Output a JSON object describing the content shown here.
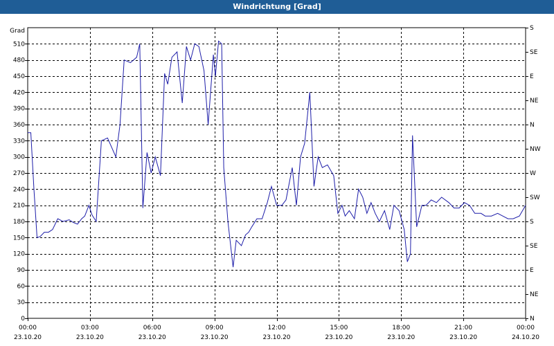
{
  "window": {
    "title": "Windrichtung [Grad]"
  },
  "colors": {
    "titlebar": "#1f5d96",
    "line": "#1c1ca8",
    "grid": "#000000"
  },
  "chart_data": {
    "type": "line",
    "title": "Windrichtung [Grad]",
    "ylabel": "Grad",
    "ylim": [
      0,
      540
    ],
    "yticks": [
      0,
      30,
      60,
      90,
      120,
      150,
      180,
      210,
      240,
      270,
      300,
      330,
      360,
      390,
      420,
      450,
      480,
      510
    ],
    "y2_labels": [
      {
        "value": 0,
        "label": "N"
      },
      {
        "value": 45,
        "label": "NE"
      },
      {
        "value": 90,
        "label": "E"
      },
      {
        "value": 135,
        "label": "SE"
      },
      {
        "value": 180,
        "label": "S"
      },
      {
        "value": 225,
        "label": "SW"
      },
      {
        "value": 270,
        "label": "W"
      },
      {
        "value": 315,
        "label": "NW"
      },
      {
        "value": 360,
        "label": "N"
      },
      {
        "value": 405,
        "label": "NE"
      },
      {
        "value": 450,
        "label": "E"
      },
      {
        "value": 495,
        "label": "SE"
      },
      {
        "value": 540,
        "label": "S"
      }
    ],
    "xlim": [
      0,
      24
    ],
    "xticks": [
      {
        "value": 0,
        "time": "00:00",
        "date": "23.10.20"
      },
      {
        "value": 3,
        "time": "03:00",
        "date": "23.10.20"
      },
      {
        "value": 6,
        "time": "06:00",
        "date": "23.10.20"
      },
      {
        "value": 9,
        "time": "09:00",
        "date": "23.10.20"
      },
      {
        "value": 12,
        "time": "12:00",
        "date": "23.10.20"
      },
      {
        "value": 15,
        "time": "15:00",
        "date": "23.10.20"
      },
      {
        "value": 18,
        "time": "18:00",
        "date": "23.10.20"
      },
      {
        "value": 21,
        "time": "21:00",
        "date": "23.10.20"
      },
      {
        "value": 24,
        "time": "00:00",
        "date": "24.10.20"
      }
    ],
    "grid": true,
    "series": [
      {
        "x": [
          0.0,
          0.15,
          0.3,
          0.45,
          0.6,
          0.8,
          1.0,
          1.2,
          1.45,
          1.7,
          2.0,
          2.2,
          2.4,
          2.6,
          2.75,
          2.95,
          3.1,
          3.3,
          3.55,
          3.85,
          4.25,
          4.45,
          4.65,
          4.95,
          5.25,
          5.4,
          5.55,
          5.75,
          5.95,
          6.15,
          6.4,
          6.6,
          6.75,
          6.95,
          7.2,
          7.45,
          7.65,
          7.85,
          8.05,
          8.25,
          8.5,
          8.7,
          8.95,
          9.05,
          9.2,
          9.35,
          9.45,
          9.65,
          9.9,
          10.05,
          10.3,
          10.5,
          10.65,
          10.8,
          11.05,
          11.3,
          11.55,
          11.75,
          12.0,
          12.25,
          12.45,
          12.75,
          12.95,
          13.15,
          13.35,
          13.6,
          13.8,
          14.0,
          14.2,
          14.45,
          14.75,
          14.95,
          15.15,
          15.3,
          15.5,
          15.75,
          15.95,
          16.15,
          16.35,
          16.55,
          16.75,
          16.95,
          17.2,
          17.45,
          17.65,
          17.9,
          18.15,
          18.3,
          18.45,
          18.55,
          18.75,
          19.0,
          19.2,
          19.45,
          19.7,
          19.95,
          20.3,
          20.55,
          20.8,
          21.05,
          21.3,
          21.55,
          21.85,
          22.05,
          22.35,
          22.65,
          22.9,
          23.15,
          23.4,
          23.7,
          24.0
        ],
        "values": [
          345,
          345,
          240,
          150,
          152,
          160,
          160,
          165,
          185,
          180,
          183,
          178,
          175,
          185,
          190,
          210,
          192,
          180,
          330,
          335,
          300,
          360,
          480,
          475,
          485,
          510,
          205,
          308,
          270,
          300,
          265,
          455,
          435,
          485,
          495,
          400,
          505,
          480,
          510,
          505,
          460,
          360,
          490,
          450,
          515,
          510,
          280,
          180,
          95,
          145,
          135,
          155,
          160,
          170,
          185,
          185,
          215,
          245,
          210,
          210,
          220,
          280,
          210,
          300,
          325,
          420,
          245,
          300,
          280,
          285,
          265,
          195,
          210,
          190,
          200,
          185,
          240,
          225,
          195,
          215,
          195,
          180,
          200,
          165,
          210,
          200,
          165,
          105,
          120,
          340,
          170,
          210,
          210,
          220,
          215,
          225,
          215,
          205,
          205,
          215,
          210,
          195,
          195,
          190,
          190,
          195,
          190,
          185,
          185,
          190,
          210
        ]
      }
    ]
  }
}
